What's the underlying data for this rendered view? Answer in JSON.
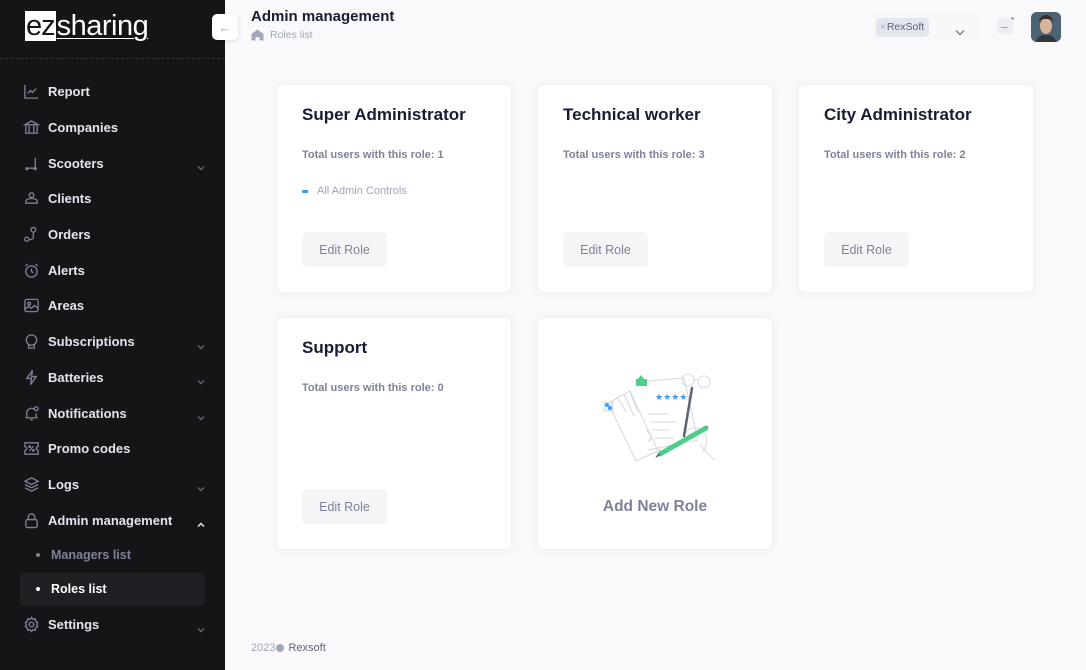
{
  "app": {
    "logo_boxed": "ez",
    "logo_rest": "sharing",
    "collapse_icon": "arrow-left-icon"
  },
  "sidebar": {
    "items": [
      {
        "label": "Report",
        "icon": "chart-line-icon",
        "has_chevron": false
      },
      {
        "label": "Companies",
        "icon": "bank-icon",
        "has_chevron": false
      },
      {
        "label": "Scooters",
        "icon": "scooter-icon",
        "has_chevron": true
      },
      {
        "label": "Clients",
        "icon": "users-icon",
        "has_chevron": false
      },
      {
        "label": "Orders",
        "icon": "route-icon",
        "has_chevron": false
      },
      {
        "label": "Alerts",
        "icon": "alarm-clock-icon",
        "has_chevron": false
      },
      {
        "label": "Areas",
        "icon": "map-image-icon",
        "has_chevron": false
      },
      {
        "label": "Subscriptions",
        "icon": "badge-icon",
        "has_chevron": true
      },
      {
        "label": "Batteries",
        "icon": "lightning-icon",
        "has_chevron": true
      },
      {
        "label": "Notifications",
        "icon": "bell-icon",
        "has_chevron": true
      },
      {
        "label": "Promo codes",
        "icon": "percent-ticket-icon",
        "has_chevron": false
      },
      {
        "label": "Logs",
        "icon": "layers-icon",
        "has_chevron": true
      },
      {
        "label": "Admin management",
        "icon": "lock-icon",
        "has_chevron": true,
        "expanded": true
      },
      {
        "label": "Settings",
        "icon": "gear-icon",
        "has_chevron": true
      }
    ],
    "admin_subitems": [
      {
        "label": "Managers list",
        "active": false
      },
      {
        "label": "Roles list",
        "active": true
      }
    ]
  },
  "header": {
    "title": "Admin management",
    "breadcrumb": "Roles list",
    "company_tag": "RexSoft",
    "tag_remove": "×"
  },
  "roles": [
    {
      "title": "Super Administrator",
      "users_text": "Total users with this role: 1",
      "permissions": [
        "All Admin Controls"
      ],
      "edit_label": "Edit Role"
    },
    {
      "title": "Technical worker",
      "users_text": "Total users with this role: 3",
      "permissions": [],
      "edit_label": "Edit Role"
    },
    {
      "title": "City Administrator",
      "users_text": "Total users with this role: 2",
      "permissions": [],
      "edit_label": "Edit Role"
    },
    {
      "title": "Support",
      "users_text": "Total users with this role: 0",
      "permissions": [],
      "edit_label": "Edit Role"
    }
  ],
  "add_role": {
    "label": "Add New Role"
  },
  "footer": {
    "year": "2023",
    "brand": "Rexsoft"
  },
  "colors": {
    "sidebar_bg": "#151518",
    "accent_blue": "#3e97ff",
    "accent_green": "#50cd89",
    "text_dark": "#181c32",
    "text_muted": "#7e8299"
  }
}
